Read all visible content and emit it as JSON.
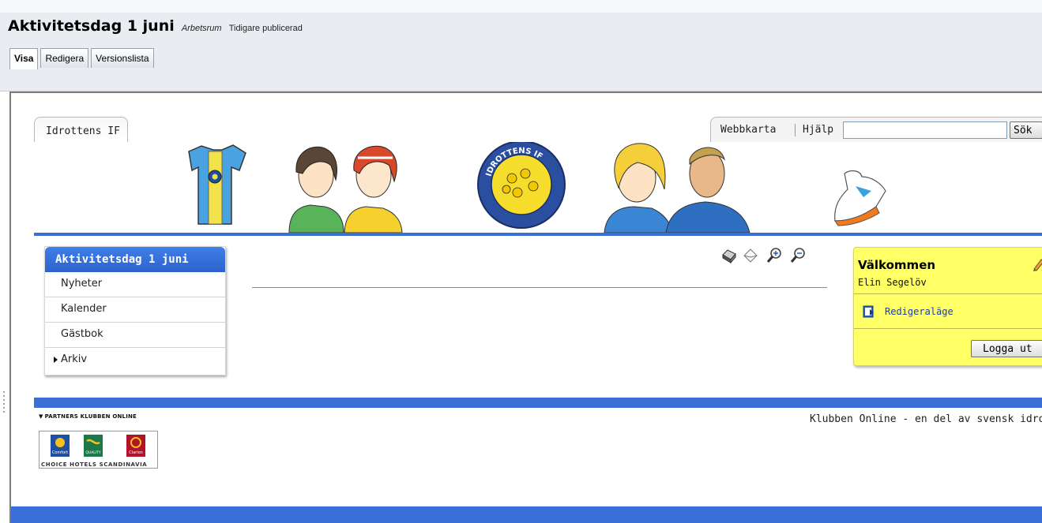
{
  "editor": {
    "page_title": "Aktivitetsdag 1 juni",
    "workspace": "Arbetsrum",
    "status": "Tidigare publicerad",
    "tabs": [
      {
        "label": "Visa",
        "active": true
      },
      {
        "label": "Redigera",
        "active": false
      },
      {
        "label": "Versionslista",
        "active": false
      }
    ]
  },
  "site": {
    "site_tab": "Idrottens IF",
    "top_nav": {
      "sitemap_label": "Webbkarta",
      "help_label": "Hjälp",
      "search_value": "",
      "search_button": "Sök"
    },
    "banner_logo_text": "IDROTTENS IF",
    "left_nav": {
      "header": "Aktivitetsdag 1 juni",
      "items": [
        {
          "label": "Nyheter",
          "has_arrow": false
        },
        {
          "label": "Kalender",
          "has_arrow": false
        },
        {
          "label": "Gästbok",
          "has_arrow": false
        },
        {
          "label": "Arkiv",
          "has_arrow": true
        }
      ]
    },
    "tools": [
      "print-icon",
      "email-icon",
      "zoom-in-icon",
      "zoom-out-icon"
    ],
    "welcome": {
      "title": "Välkommen",
      "user": "Elin Segelöv",
      "edit_mode_label": "Redigeraläge",
      "logout_label": "Logga ut"
    },
    "footer": {
      "partners_label": "PARTNERS KLUBBEN ONLINE",
      "tagline": "Klubben Online - en del av svensk idro",
      "partner_logo": {
        "brands": [
          "Comfort",
          "QUALITY",
          "Clarion"
        ],
        "caption": "CHOICE HOTELS SCANDINAVIA"
      }
    }
  },
  "colors": {
    "accent_blue": "#3b6fd8",
    "welcome_yellow": "#ffff66",
    "chrome_bg": "#e9edf2"
  }
}
